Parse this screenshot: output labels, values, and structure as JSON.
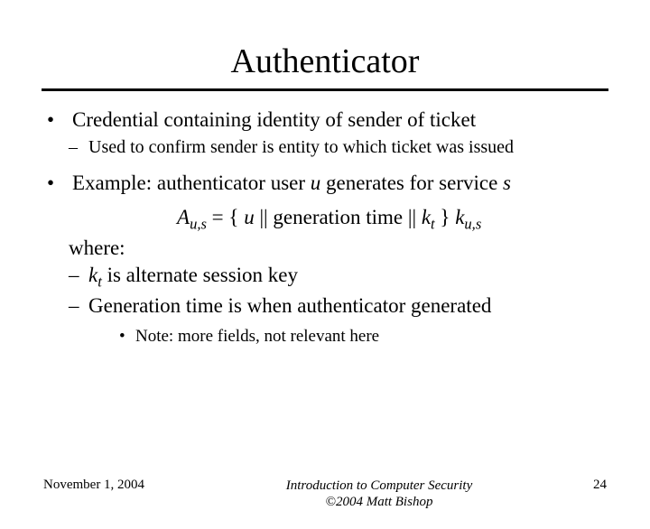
{
  "title": "Authenticator",
  "bullets": {
    "b1": "Credential containing identity of sender of ticket",
    "b1_sub1": "Used to confirm sender is entity to which ticket was issued",
    "b2_pre": "Example: authenticator user ",
    "b2_u": "u",
    "b2_mid": " generates for service ",
    "b2_s": "s"
  },
  "formula": {
    "A": "A",
    "sub_us": "u,s",
    "eq": " = { ",
    "u": "u",
    "sep1": " || generation time || ",
    "kt": "k",
    "kt_sub": "t",
    "close": " } ",
    "k": "k",
    "k_sub": "u,s"
  },
  "where": {
    "label": "where:",
    "d1_k": "k",
    "d1_sub": "t",
    "d1_rest": " is alternate session key",
    "d2": "Generation time is when authenticator generated"
  },
  "note": "Note: more fields, not relevant here",
  "footer": {
    "date": "November 1, 2004",
    "center1": "Introduction to Computer Security",
    "center2": "©2004 Matt Bishop",
    "page": "24"
  }
}
